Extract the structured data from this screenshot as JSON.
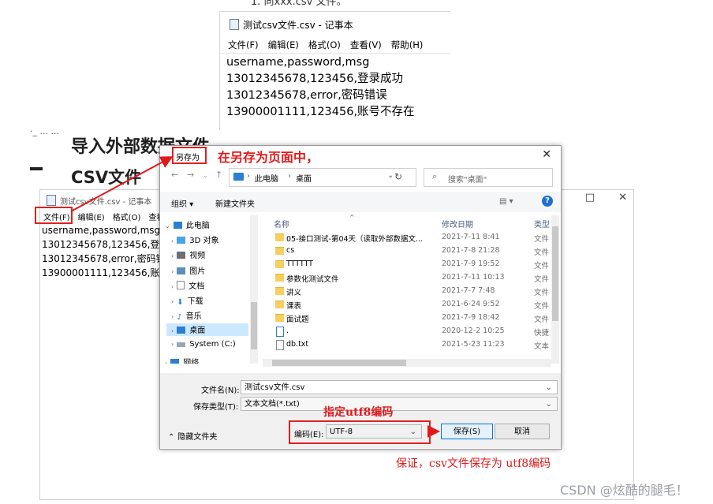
{
  "top_fragment": "1. 向xxx.csv 文件。",
  "notepad_top": {
    "title": "测试csv文件.csv - 记事本",
    "menu": [
      "文件(F)",
      "编辑(E)",
      "格式(O)",
      "查看(V)",
      "帮助(H)"
    ],
    "lines": [
      "username,password,msg",
      "13012345678,123456,登录成功",
      "13012345678,error,密码错误",
      "13900001111,123456,账号不存在"
    ]
  },
  "blog": {
    "fragment": "导入外部数据文件",
    "heading": "CSV文件"
  },
  "notepad_bottom": {
    "title": "测试csv文件.csv - 记事本",
    "menu": [
      "文件(F)",
      "编辑(E)",
      "格式(O)",
      "查看"
    ],
    "lines": [
      "username,password,msg",
      "13012345678,123456,登录",
      "13012345678,error,密码错",
      "13900001111,123456,账号"
    ],
    "winbtns": [
      "—",
      "□",
      "✕"
    ]
  },
  "dialog": {
    "title": "另存为",
    "close": "✕",
    "address": [
      "此电脑",
      "桌面"
    ],
    "search_placeholder": "搜索\"桌面\"",
    "toolbar": {
      "organize": "组织 ▾",
      "new_folder": "新建文件夹",
      "help": "?"
    },
    "nav": [
      {
        "label": "此电脑",
        "icon": "computer-icon",
        "expanded": true
      },
      {
        "label": "3D 对象",
        "icon": "cube-icon"
      },
      {
        "label": "视频",
        "icon": "video-icon"
      },
      {
        "label": "图片",
        "icon": "picture-icon"
      },
      {
        "label": "文档",
        "icon": "document-icon"
      },
      {
        "label": "下载",
        "icon": "download-icon"
      },
      {
        "label": "音乐",
        "icon": "music-icon"
      },
      {
        "label": "桌面",
        "icon": "desktop-icon",
        "selected": true
      },
      {
        "label": "System (C:)",
        "icon": "drive-icon"
      },
      {
        "label": "网络",
        "icon": "network-icon"
      }
    ],
    "columns": [
      "名称",
      "修改日期",
      "类型"
    ],
    "files": [
      {
        "name": "05-接口测试-第04天（读取外部数据文...",
        "date": "2021-7-11 8:41",
        "type": "文件",
        "kind": "folder"
      },
      {
        "name": "cs",
        "date": "2021-7-8 21:28",
        "type": "文件",
        "kind": "folder"
      },
      {
        "name": "TTTTTT",
        "date": "2021-7-9 19:52",
        "type": "文件",
        "kind": "folder"
      },
      {
        "name": "参数化测试文件",
        "date": "2021-7-11 10:13",
        "type": "文件",
        "kind": "folder"
      },
      {
        "name": "讲义",
        "date": "2021-7-7 7:48",
        "type": "文件",
        "kind": "folder"
      },
      {
        "name": "课表",
        "date": "2021-6-24 9:52",
        "type": "文件",
        "kind": "folder"
      },
      {
        "name": "面试题",
        "date": "2021-7-9 18:42",
        "type": "文件",
        "kind": "folder"
      },
      {
        "name": ".",
        "date": "2020-12-2 10:25",
        "type": "快捷",
        "kind": "shortcut"
      },
      {
        "name": "db.txt",
        "date": "2021-5-23 11:23",
        "type": "文本",
        "kind": "doc"
      }
    ],
    "filename_label": "文件名(N):",
    "filename_value": "测试csv文件.csv",
    "filetype_label": "保存类型(T):",
    "filetype_value": "文本文档(*.txt)",
    "hide_folders": "隐藏文件夹",
    "encoding_label": "编码(E):",
    "encoding_value": "UTF-8",
    "save_button": "保存(S)",
    "cancel_button": "取消"
  },
  "annotations": {
    "save_as_page": "在另存为页面中，",
    "specify_utf8": "指定utf8编码",
    "ensure": "保证，csv文件保存为 utf8编码"
  },
  "watermark": "CSDN @炫酷的腿毛！",
  "colors": {
    "annotation_red": "#e0191b",
    "selection_blue": "#cce8ff",
    "folder_yellow": "#f6cf5e"
  }
}
